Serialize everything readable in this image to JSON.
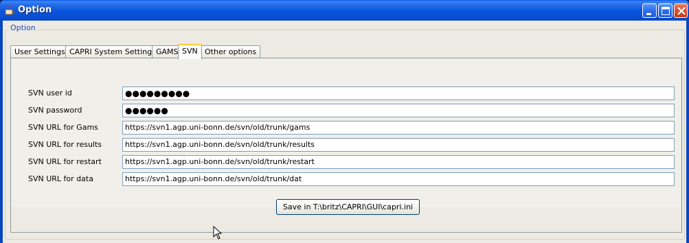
{
  "window": {
    "title": "Option",
    "controls": [
      "minimize-icon",
      "maximize-icon",
      "close-icon"
    ]
  },
  "group": {
    "legend": "Option"
  },
  "tabs": [
    {
      "label": "User Settings",
      "active": false
    },
    {
      "label": "CAPRI System Settings",
      "active": false
    },
    {
      "label": "GAMS",
      "active": false
    },
    {
      "label": "SVN",
      "active": true
    },
    {
      "label": "Other options",
      "active": false
    }
  ],
  "svn": {
    "fields": [
      {
        "label": "SVN user id",
        "value": "●●●●●●●●●",
        "masked": true
      },
      {
        "label": "SVN password",
        "value": "●●●●●●",
        "masked": true
      },
      {
        "label": "SVN URL for Gams",
        "value": "https://svn1.agp.uni-bonn.de/svn/old/trunk/gams"
      },
      {
        "label": "SVN URL for results",
        "value": "https://svn1.agp.uni-bonn.de/svn/old/trunk/results"
      },
      {
        "label": "SVN URL for restart",
        "value": "https://svn1.agp.uni-bonn.de/svn/old/trunk/restart"
      },
      {
        "label": "SVN URL for data",
        "value": "https://svn1.agp.uni-bonn.de/svn/old/trunk/dat"
      }
    ]
  },
  "save_button": {
    "label": "Save in T:\\britz\\CAPRI\\GUI\\capri.ini"
  },
  "colors": {
    "titlebar": "#0855dd",
    "legend": "#1c47c7",
    "active_tab_accent": "#ffc83c"
  }
}
